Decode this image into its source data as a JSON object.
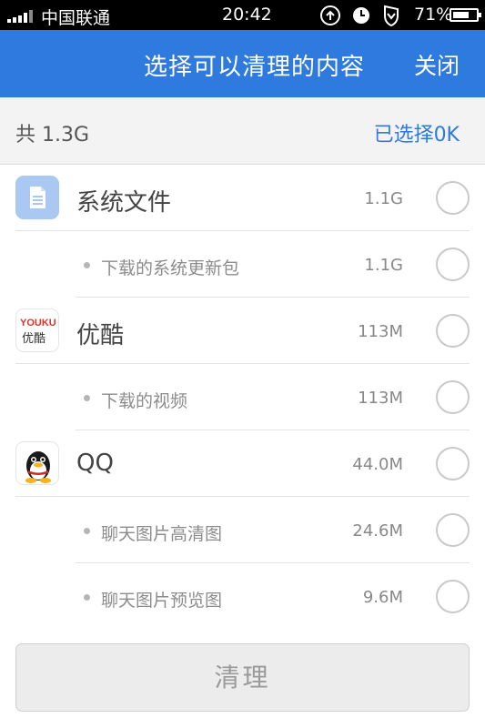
{
  "status_bar": {
    "carrier": "中国联通",
    "time": "20:42",
    "battery_percent_text": "71%",
    "battery_level": 0.71,
    "icons": [
      "signal-icon",
      "sync-icon",
      "clock-icon",
      "shield-icon",
      "battery-icon"
    ]
  },
  "header": {
    "title": "选择可以清理的内容",
    "close_label": "关闭",
    "accent_color": "#2f7ade"
  },
  "summary": {
    "total": "共 1.3G",
    "selected": "已选择0K"
  },
  "items": [
    {
      "type": "group",
      "icon": "file-icon",
      "label": "系统文件",
      "size": "1.1G",
      "checked": false
    },
    {
      "type": "sub",
      "label": "下载的系统更新包",
      "size": "1.1G",
      "checked": false
    },
    {
      "type": "group",
      "icon": "youku-icon",
      "icon_text_top": "YOUKU",
      "icon_text_bottom": "优酷",
      "label": "优酷",
      "size": "113M",
      "checked": false
    },
    {
      "type": "sub",
      "label": "下载的视频",
      "size": "113M",
      "checked": false
    },
    {
      "type": "group",
      "icon": "qq-penguin-icon",
      "label": "QQ",
      "size": "44.0M",
      "checked": false
    },
    {
      "type": "sub",
      "label": "聊天图片高清图",
      "size": "24.6M",
      "checked": false
    },
    {
      "type": "sub",
      "label": "聊天图片预览图",
      "size": "9.6M",
      "checked": false
    }
  ],
  "clean_button_label": "清理"
}
